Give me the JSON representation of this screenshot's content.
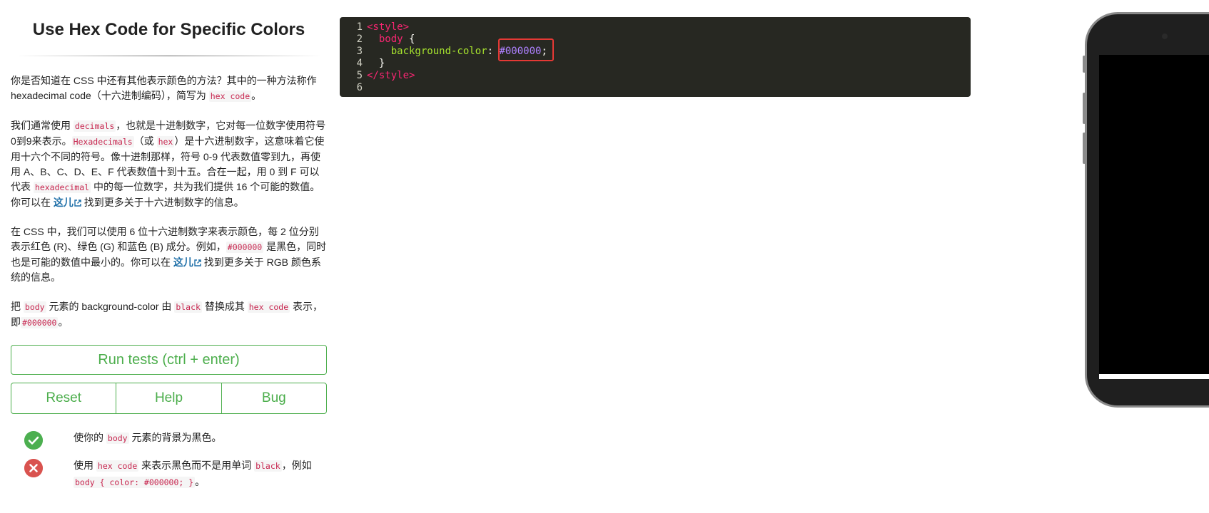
{
  "challenge": {
    "title": "Use Hex Code for Specific Colors"
  },
  "description": {
    "p1": {
      "t1": "你是否知道在 CSS 中还有其他表示颜色的方法？其中的一种方法称作 hexadecimal code（十六进制编码），简写为 ",
      "c1": "hex code",
      "t2": "。"
    },
    "p2": {
      "t1": "我们通常使用 ",
      "c1": "decimals",
      "t2": "，也就是十进制数字，它对每一位数字使用符号0到9来表示。",
      "c2": "Hexadecimals",
      "t3": "（或 ",
      "c3": "hex",
      "t4": "）是十六进制数字，这意味着它使用十六个不同的符号。像十进制那样，符号 0-9 代表数值零到九，再使用 A、B、C、D、E、F 代表数值十到十五。合在一起，用 0 到 F 可以代表 ",
      "c4": "hexadecimal",
      "t5": " 中的每一位数字，共为我们提供 16 个可能的数值。你可以在 ",
      "link": "这儿",
      "t6": " 找到更多关于十六进制数字的信息。"
    },
    "p3": {
      "t1": "在 CSS 中，我们可以使用 6 位十六进制数字来表示颜色，每 2 位分别表示红色 (R)、绿色 (G) 和蓝色 (B) 成分。例如，",
      "c1": "#000000",
      "t2": " 是黑色，同时也是可能的数值中最小的。你可以在 ",
      "link": "这儿",
      "t3": " 找到更多关于 RGB 颜色系统的信息。"
    },
    "p4": {
      "t1": "把 ",
      "c1": "body",
      "t2": " 元素的 background-color 由 ",
      "c2": "black",
      "t3": " 替换成其 ",
      "c3": "hex code",
      "t4": " 表示，即",
      "c4": "#000000",
      "t5": "。"
    }
  },
  "buttons": {
    "run": "Run tests (ctrl + enter)",
    "reset": "Reset",
    "help": "Help",
    "bug": "Bug"
  },
  "tests": [
    {
      "status": "pass",
      "t1": "使你的 ",
      "c1": "body",
      "t2": " 元素的背景为黑色。"
    },
    {
      "status": "fail",
      "t1": "使用 ",
      "c1": "hex code",
      "t2": " 来表示黑色而不是用单词 ",
      "c2": "black",
      "t3": "，例如 ",
      "c3": "body { color: #000000; }",
      "t4": "。"
    }
  ],
  "editor": {
    "line_numbers": [
      "1",
      "2",
      "3",
      "4",
      "5",
      "6"
    ],
    "l1": "<style>",
    "l2_sel": "body",
    "l2_brace": " {",
    "l3_prop": "background-color",
    "l3_colon": ": ",
    "l3_val": "#000000",
    "l3_end": ";",
    "l4": "}",
    "l5": "</style>"
  },
  "colors": {
    "accent_green": "#4cae4c",
    "pass": "#4caf50",
    "fail": "#d9534f",
    "editor_bg": "#272822",
    "highlight_border": "#e53935",
    "preview_bg": "#000000"
  },
  "icons": {
    "pass": "check-circle-icon",
    "fail": "x-circle-icon",
    "link": "external-link-icon"
  }
}
